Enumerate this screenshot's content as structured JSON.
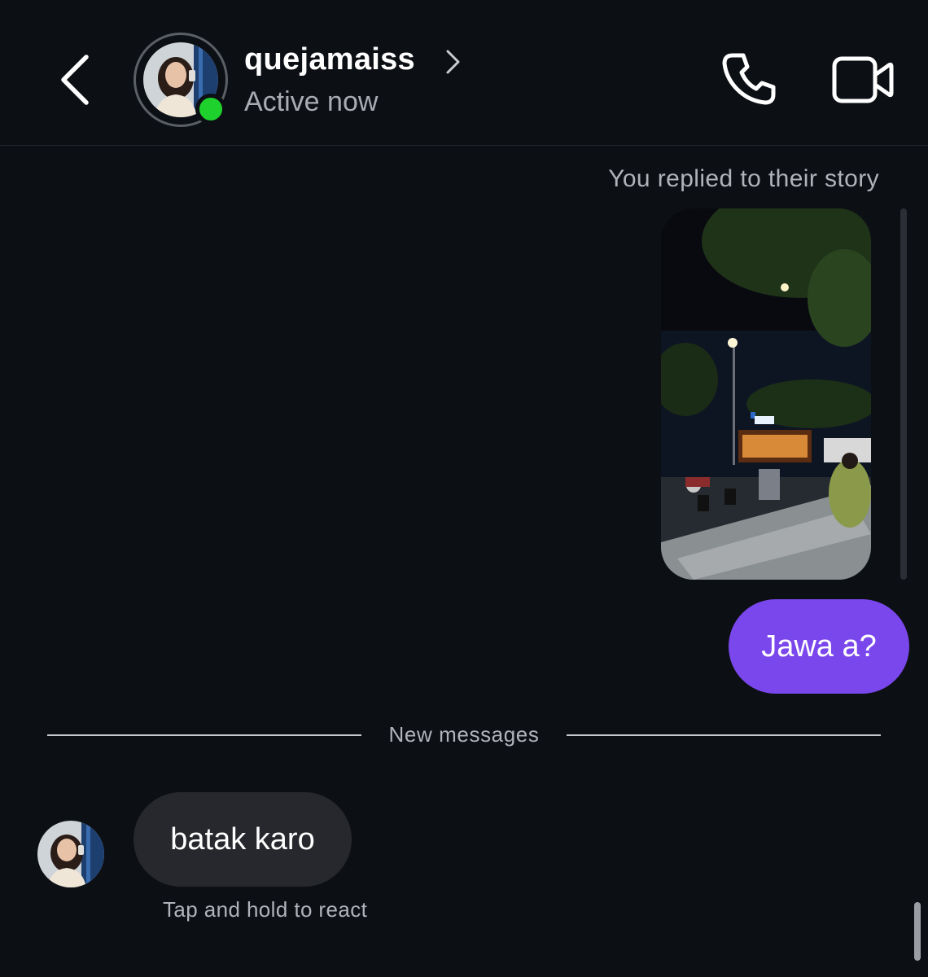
{
  "header": {
    "username": "quejamaiss",
    "status": "Active now",
    "icons": {
      "back": "chevron-left-icon",
      "profile": "chevron-right-icon",
      "call": "phone-icon",
      "video": "video-camera-icon"
    },
    "online_indicator_color": "#1ed12d"
  },
  "conversation": {
    "story_reply_note": "You replied to their story",
    "outgoing_message": "Jawa a?",
    "outgoing_bubble_color": "#7a47ec",
    "divider_label": "New messages",
    "incoming_message": "batak karo",
    "incoming_bubble_color": "#26282d",
    "react_hint": "Tap and hold to react"
  },
  "theme": {
    "background": "#0c0f14"
  }
}
